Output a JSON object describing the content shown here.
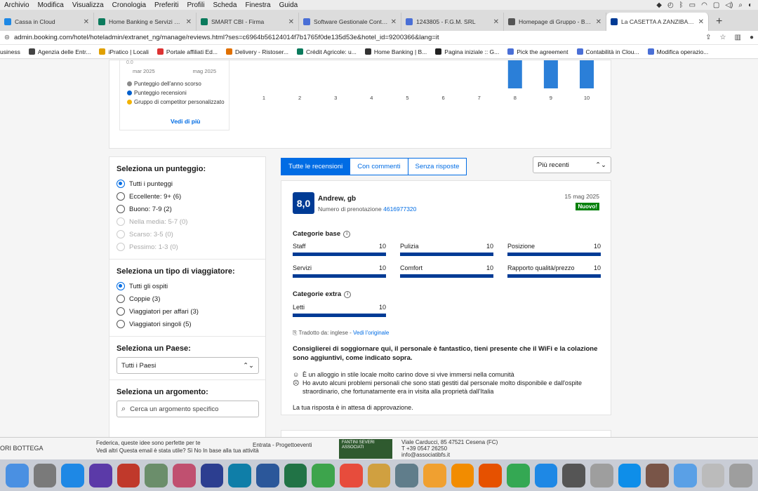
{
  "menubar": {
    "items": [
      "Archivio",
      "Modifica",
      "Visualizza",
      "Cronologia",
      "Preferiti",
      "Profili",
      "Scheda",
      "Finestra",
      "Guida"
    ]
  },
  "tabs": [
    {
      "title": "Cassa in Cloud",
      "color": "#1e88e5"
    },
    {
      "title": "Home Banking e Servizi Digi",
      "color": "#0a7a5c"
    },
    {
      "title": "SMART CBI - Firma",
      "color": "#0a7a5c"
    },
    {
      "title": "Software Gestionale Contab",
      "color": "#4a6fd6"
    },
    {
      "title": "1243805 - F.G.M. SRL",
      "color": "#4a6fd6"
    },
    {
      "title": "Homepage di Gruppo - Book",
      "color": "#555555"
    },
    {
      "title": "La CASETTA A ZANZIBAR Bo",
      "color": "#003b95"
    }
  ],
  "address": {
    "url": "admin.booking.com/hotel/hoteladmin/extranet_ng/manage/reviews.html?ses=c6964b56124014f7b1765f0de135d53e&hotel_id=9200366&lang=it"
  },
  "bookmarks": [
    {
      "label": "usiness",
      "color": "#888888"
    },
    {
      "label": "Agenzia delle Entr...",
      "color": "#444444"
    },
    {
      "label": "iPratico | Locali",
      "color": "#e0a000"
    },
    {
      "label": "Portale affiliati Ed...",
      "color": "#d33"
    },
    {
      "label": "Delivery - Ristoser...",
      "color": "#e07000"
    },
    {
      "label": "Crédit Agricole: u...",
      "color": "#0a7a5c"
    },
    {
      "label": "Home Banking | B...",
      "color": "#333333"
    },
    {
      "label": "Pagina iniziale :: G...",
      "color": "#222222"
    },
    {
      "label": "Pick the agreement",
      "color": "#4a6fd6"
    },
    {
      "label": "Contabilità in Clou...",
      "color": "#4a6fd6"
    },
    {
      "label": "Modifica operazio...",
      "color": "#4a6fd6"
    }
  ],
  "stats": {
    "y_tick_top": "0.0",
    "dates": [
      "mar 2025",
      "mag 2025"
    ],
    "legend": [
      {
        "label": "Punteggio dell'anno scorso",
        "color": "#8a8a8a"
      },
      {
        "label": "Punteggio recensioni",
        "color": "#005fcc"
      },
      {
        "label": "Gruppo di competitor personalizzato",
        "color": "#f2b200"
      }
    ],
    "see_more": "Vedi di più"
  },
  "chart_data": {
    "type": "bar",
    "categories": [
      "1",
      "2",
      "3",
      "4",
      "5",
      "6",
      "7",
      "8",
      "9",
      "10"
    ],
    "values": [
      0,
      0,
      0,
      0,
      0,
      0,
      0,
      1,
      1,
      1
    ],
    "series_color": "#2b7fd8",
    "ylabel": "",
    "ytick": "0.0"
  },
  "filters": {
    "score": {
      "title": "Seleziona un punteggio:",
      "options": [
        {
          "label": "Tutti i punteggi",
          "state": "checked"
        },
        {
          "label": "Eccellente: 9+ (6)",
          "state": "normal"
        },
        {
          "label": "Buono: 7-9 (2)",
          "state": "normal"
        },
        {
          "label": "Nella media: 5-7 (0)",
          "state": "disabled"
        },
        {
          "label": "Scarso: 3-5 (0)",
          "state": "disabled"
        },
        {
          "label": "Pessimo: 1-3 (0)",
          "state": "disabled"
        }
      ]
    },
    "traveler": {
      "title": "Seleziona un tipo di viaggiatore:",
      "options": [
        {
          "label": "Tutti gli ospiti",
          "state": "checked"
        },
        {
          "label": "Coppie (3)",
          "state": "normal"
        },
        {
          "label": "Viaggiatori per affari (3)",
          "state": "normal"
        },
        {
          "label": "Viaggiatori singoli (5)",
          "state": "normal"
        }
      ]
    },
    "country": {
      "title": "Seleziona un Paese:",
      "value": "Tutti i Paesi"
    },
    "topic": {
      "title": "Seleziona un argomento:",
      "placeholder": "Cerca un argomento specifico"
    }
  },
  "review_tabs": [
    "Tutte le recensioni",
    "Con commenti",
    "Senza risposte"
  ],
  "sort": {
    "value": "Più recenti"
  },
  "review": {
    "score": "8,0",
    "name": "Andrew, gb",
    "booking_label": "Numero di prenotazione",
    "booking_number": "4616977320",
    "date": "15 mag 2025",
    "badge": "Nuovo!",
    "base_title": "Categorie base",
    "base": [
      {
        "label": "Staff",
        "value": "10",
        "fraction": 1.0
      },
      {
        "label": "Pulizia",
        "value": "10",
        "fraction": 1.0
      },
      {
        "label": "Posizione",
        "value": "10",
        "fraction": 1.0
      },
      {
        "label": "Servizi",
        "value": "10",
        "fraction": 1.0
      },
      {
        "label": "Comfort",
        "value": "10",
        "fraction": 1.0
      },
      {
        "label": "Rapporto qualità/prezzo",
        "value": "10",
        "fraction": 1.0
      }
    ],
    "extra_title": "Categorie extra",
    "extra": [
      {
        "label": "Letti",
        "value": "10",
        "fraction": 1.0
      }
    ],
    "translated": "Tradotto da: inglese",
    "see_original": "Vedi l'originale",
    "title": "Consiglierei di soggiornare qui, il personale è fantastico, tieni presente che il WiFi e la colazione sono aggiuntivi, come indicato sopra.",
    "positive": "È un alloggio in stile locale molto carino dove si vive immersi nella comunità",
    "negative": "Ho avuto alcuni problemi personali che sono stati gestiti dal personale molto disponibile e dall'ospite straordinario, che fortunatamente era in visita alla proprietà dall'Italia",
    "pending": "La tua risposta è in attesa di approvazione."
  },
  "underlying": {
    "left": "ORI BOTTEGA",
    "mail_line1": "Federica, queste idee sono perfette per te",
    "mail_line2": "Vedi altri   Questa email è stata utile? Sì No   In base alla tua attività",
    "mail_meta": "Entrata - Progettoeventi",
    "logo_text": "FANTINI SEVERI ASSOCIATI",
    "addr1": "Viale Carducci, 85 47521 Cesena (FC)",
    "addr2": "T +39 0547 26250",
    "addr3": "info@associatibfs.it"
  },
  "dock": [
    {
      "name": "finder",
      "color": "#4a90e2"
    },
    {
      "name": "launchpad",
      "color": "#7a7a7a"
    },
    {
      "name": "app-store",
      "color": "#1e88e5"
    },
    {
      "name": "siri",
      "color": "#5b3aa8"
    },
    {
      "name": "remote-desktop",
      "color": "#c0392b"
    },
    {
      "name": "preview",
      "color": "#6b8e6b"
    },
    {
      "name": "photos",
      "color": "#c05070"
    },
    {
      "name": "settings",
      "color": "#2c3e90"
    },
    {
      "name": "edge",
      "color": "#0f7ea8"
    },
    {
      "name": "word",
      "color": "#2b579a"
    },
    {
      "name": "excel",
      "color": "#217346"
    },
    {
      "name": "numbers",
      "color": "#3da44c"
    },
    {
      "name": "calendar",
      "color": "#e74c3c"
    },
    {
      "name": "textedit",
      "color": "#d0a040"
    },
    {
      "name": "mail",
      "color": "#607d8b"
    },
    {
      "name": "photos-2",
      "color": "#f0a030"
    },
    {
      "name": "vlc",
      "color": "#f28c00"
    },
    {
      "name": "firefox",
      "color": "#e65100"
    },
    {
      "name": "chrome",
      "color": "#34a853"
    },
    {
      "name": "safari",
      "color": "#1e88e5"
    },
    {
      "name": "tool",
      "color": "#555555"
    },
    {
      "name": "help",
      "color": "#9e9e9e"
    },
    {
      "name": "teamviewer",
      "color": "#0e8ee9"
    },
    {
      "name": "utility",
      "color": "#795548"
    },
    {
      "name": "folder",
      "color": "#5aa0e6"
    },
    {
      "name": "window",
      "color": "#bbbbbb"
    },
    {
      "name": "trash",
      "color": "#9e9e9e"
    }
  ]
}
